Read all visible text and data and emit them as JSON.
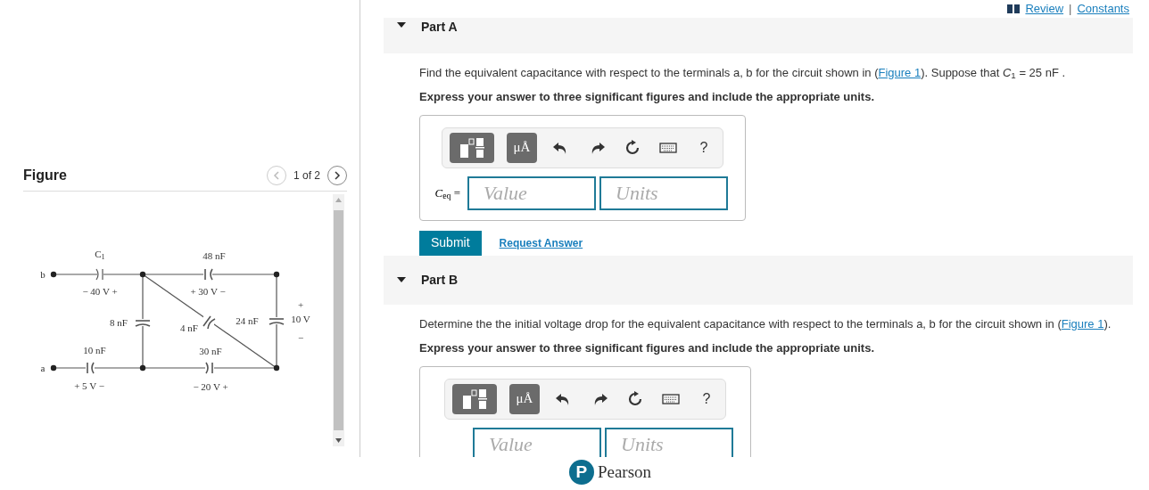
{
  "top_links": {
    "review": "Review",
    "separator": "|",
    "constants": "Constants"
  },
  "figure_panel": {
    "title": "Figure",
    "pager": "1 of 2",
    "labels": [
      "C$_{1}$",
      "− 40 V +",
      "48 nF",
      "+ 30 V −",
      "8 nF",
      "4 nF",
      "24 nF",
      "+",
      "10 V",
      "−",
      "10 nF",
      "+ 5 V −",
      "30 nF",
      "− 20 V +",
      "b",
      "a"
    ]
  },
  "parts": [
    {
      "title": "Part A",
      "expanded": true,
      "question": {
        "before": "Find the equivalent capacitance with respect to the terminals a, b for the circuit shown in (",
        "link": "Figure 1",
        "after": "). Suppose that *C*$_{1}$ = 25 nF ."
      },
      "instruction": "Express your answer to three significant figures and include the appropriate units.",
      "toolbar": {
        "units_button": "μÅ",
        "help": "?"
      },
      "answer": {
        "label": "*C*$_{eq}$ =",
        "value_placeholder": "Value",
        "units_placeholder": "Units"
      },
      "submit": "Submit",
      "request": "Request Answer"
    },
    {
      "title": "Part B",
      "expanded": true,
      "question": {
        "before": "Determine the the initial voltage drop for the equivalent capacitance with respect to the terminals a, b for the circuit shown in (",
        "link": "Figure 1",
        "after": ")."
      },
      "instruction": "Express your answer to three significant figures and include the appropriate units.",
      "toolbar": {
        "units_button": "μÅ",
        "help": "?"
      },
      "answer": {
        "value_placeholder": "Value",
        "units_placeholder": "Units"
      }
    }
  ],
  "footer": {
    "logo_mark": "P",
    "logo_text": "Pearson"
  }
}
